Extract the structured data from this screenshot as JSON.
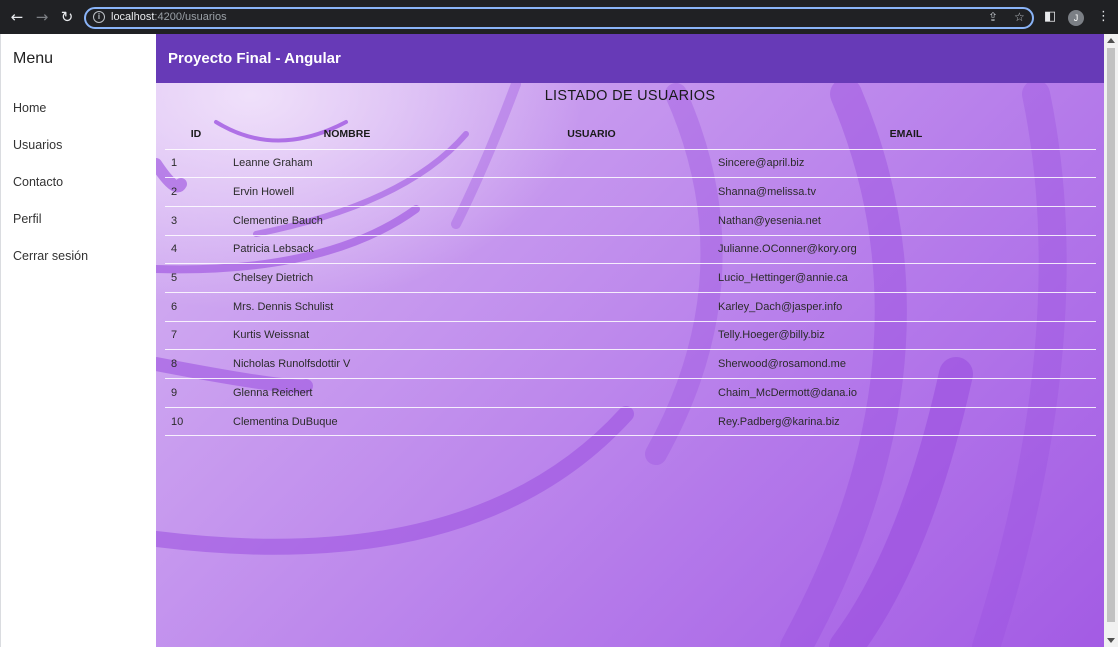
{
  "browser": {
    "url_host": "localhost",
    "url_path": ":4200/usuarios",
    "profile_initial": "J"
  },
  "sidebar": {
    "title": "Menu",
    "items": [
      {
        "label": "Home"
      },
      {
        "label": "Usuarios"
      },
      {
        "label": "Contacto"
      },
      {
        "label": "Perfil"
      },
      {
        "label": "Cerrar sesión"
      }
    ]
  },
  "toolbar": {
    "title": "Proyecto Final - Angular"
  },
  "main": {
    "heading": "LISTADO DE USUARIOS",
    "columns": [
      "ID",
      "NOMBRE",
      "USUARIO",
      "EMAIL"
    ],
    "rows": [
      {
        "id": "1",
        "name": "Leanne Graham",
        "user": "",
        "email": "Sincere@april.biz"
      },
      {
        "id": "2",
        "name": "Ervin Howell",
        "user": "",
        "email": "Shanna@melissa.tv"
      },
      {
        "id": "3",
        "name": "Clementine Bauch",
        "user": "",
        "email": "Nathan@yesenia.net"
      },
      {
        "id": "4",
        "name": "Patricia Lebsack",
        "user": "",
        "email": "Julianne.OConner@kory.org"
      },
      {
        "id": "5",
        "name": "Chelsey Dietrich",
        "user": "",
        "email": "Lucio_Hettinger@annie.ca"
      },
      {
        "id": "6",
        "name": "Mrs. Dennis Schulist",
        "user": "",
        "email": "Karley_Dach@jasper.info"
      },
      {
        "id": "7",
        "name": "Kurtis Weissnat",
        "user": "",
        "email": "Telly.Hoeger@billy.biz"
      },
      {
        "id": "8",
        "name": "Nicholas Runolfsdottir V",
        "user": "",
        "email": "Sherwood@rosamond.me"
      },
      {
        "id": "9",
        "name": "Glenna Reichert",
        "user": "",
        "email": "Chaim_McDermott@dana.io"
      },
      {
        "id": "10",
        "name": "Clementina DuBuque",
        "user": "",
        "email": "Rey.Padberg@karina.biz"
      }
    ]
  },
  "colors": {
    "toolbar": "#673ab7",
    "background_light": "#d7b7f3",
    "background_dark": "#a35be4"
  }
}
